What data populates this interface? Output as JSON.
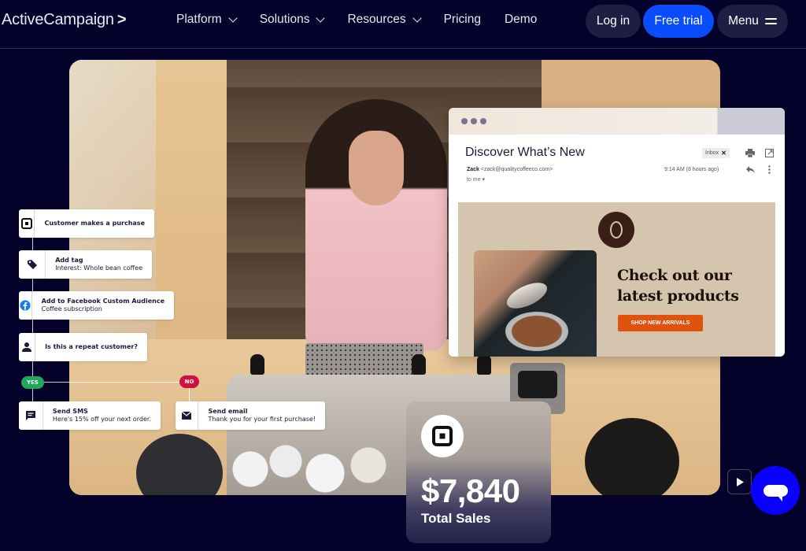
{
  "header": {
    "logo_text": "ActiveCampaign",
    "logo_mark": ">",
    "nav": [
      {
        "label": "Platform",
        "has_dropdown": true
      },
      {
        "label": "Solutions",
        "has_dropdown": true
      },
      {
        "label": "Resources",
        "has_dropdown": true
      },
      {
        "label": "Pricing",
        "has_dropdown": false
      },
      {
        "label": "Demo",
        "has_dropdown": false
      }
    ],
    "login_label": "Log in",
    "trial_label": "Free trial",
    "menu_label": "Menu"
  },
  "colors": {
    "background": "#04022b",
    "primary_button": "#0a4dff",
    "secondary_button": "#1f1d43",
    "yes_badge": "#1fa85a",
    "no_badge": "#d0103f",
    "shop_button": "#e0520e",
    "chat_button": "#0a00ff"
  },
  "workflow": {
    "steps": [
      {
        "icon": "square-pos-icon",
        "title": "Customer makes a purchase",
        "subtitle": ""
      },
      {
        "icon": "tag-icon",
        "title": "Add tag",
        "subtitle": "Interest: Whole bean coffee"
      },
      {
        "icon": "facebook-icon",
        "title": "Add to Facebook Custom Audience",
        "subtitle": "Coffee subscription"
      },
      {
        "icon": "person-icon",
        "title": "Is this a repeat customer?",
        "subtitle": ""
      }
    ],
    "yes_label": "YES",
    "no_label": "NO",
    "yes_action": {
      "icon": "sms-icon",
      "title": "Send SMS",
      "subtitle": "Here's 15% off your next order."
    },
    "no_action": {
      "icon": "email-icon",
      "title": "Send email",
      "subtitle": "Thank you for your first purchase!"
    }
  },
  "email": {
    "subject": "Discover What’s New",
    "inbox_tag": "Inbox",
    "sender_name": "Zack",
    "sender_email": "<zack@qualitycoffeeco.com>",
    "recipient": "to me",
    "time": "9:14 AM (8 hours ago)",
    "promo_title_line1": "Check out our",
    "promo_title_line2": "latest products",
    "cta_label": "SHOP NEW ARRIVALS"
  },
  "sales": {
    "value": "$7,840",
    "label": "Total Sales"
  }
}
